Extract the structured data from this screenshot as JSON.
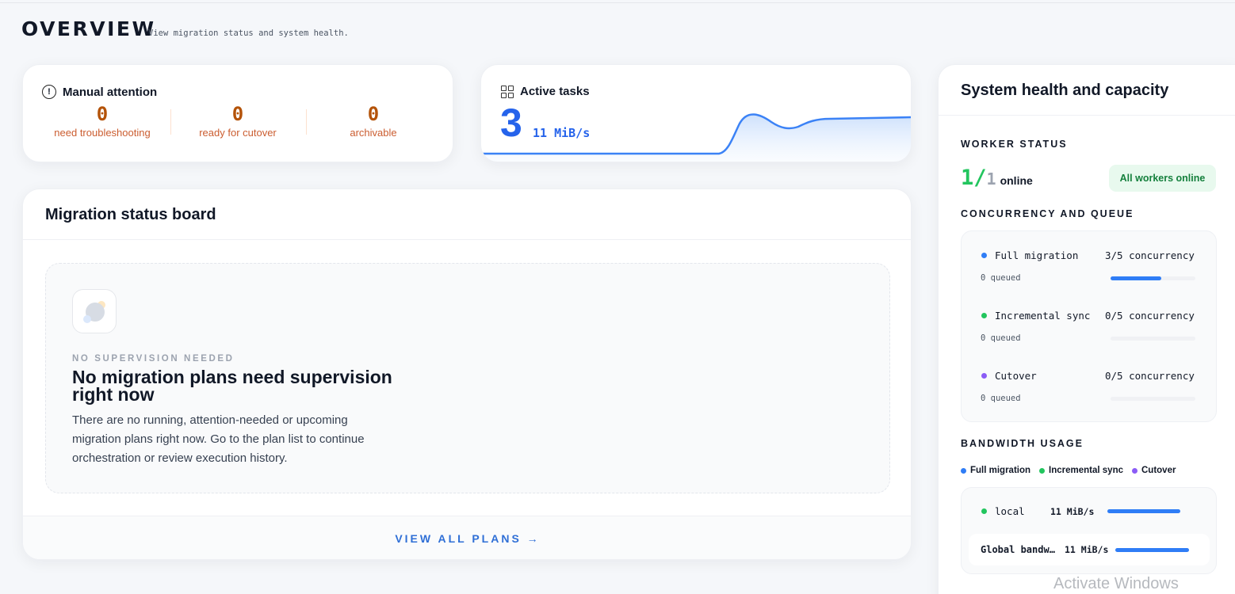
{
  "header": {
    "title": "OVERVIEW",
    "subtitle": "View migration status and system health."
  },
  "manual_attention": {
    "title": "Manual attention",
    "icon": "info-circle-icon",
    "metrics": [
      {
        "value": "0",
        "label": "need troubleshooting"
      },
      {
        "value": "0",
        "label": "ready for cutover"
      },
      {
        "value": "0",
        "label": "archivable"
      }
    ]
  },
  "active_tasks": {
    "title": "Active tasks",
    "icon": "grid-icon",
    "count": "3",
    "rate": "11 MiB/s"
  },
  "board": {
    "title": "Migration status board",
    "empty_kicker": "NO SUPERVISION NEEDED",
    "empty_title": "No migration plans need supervision right now",
    "empty_description": "There are no running, attention-needed or upcoming migration plans right now. Go to the plan list to continue orchestration or review execution history.",
    "view_all": "VIEW ALL PLANS →"
  },
  "health": {
    "title": "System health and capacity",
    "worker_label": "WORKER STATUS",
    "workers_online": "1",
    "workers_sep": "/",
    "workers_total": "1",
    "online_label": "online",
    "workers_badge": "All workers online",
    "queue_label": "CONCURRENCY AND QUEUE",
    "queues": [
      {
        "name": "Full migration",
        "concurrency": "3/5 concurrency",
        "queued": "0 queued",
        "color": "#2f7df6",
        "fill": 0.6
      },
      {
        "name": "Incremental sync",
        "concurrency": "0/5 concurrency",
        "queued": "0 queued",
        "color": "#22c55e",
        "fill": 0
      },
      {
        "name": "Cutover",
        "concurrency": "0/5 concurrency",
        "queued": "0 queued",
        "color": "#8b5cf6",
        "fill": 0
      }
    ],
    "bandwidth_label": "BANDWIDTH USAGE",
    "legend": [
      {
        "label": "Full migration",
        "color": "#2f7df6"
      },
      {
        "label": "Incremental sync",
        "color": "#22c55e"
      },
      {
        "label": "Cutover",
        "color": "#8b5cf6"
      }
    ],
    "bandwidth_local": {
      "name": "local",
      "rate": "11 MiB/s",
      "color": "#22c55e"
    },
    "bandwidth_global": {
      "name": "Global bandwidth",
      "rate": "11 MiB/s"
    }
  },
  "watermark": "Activate Windows"
}
